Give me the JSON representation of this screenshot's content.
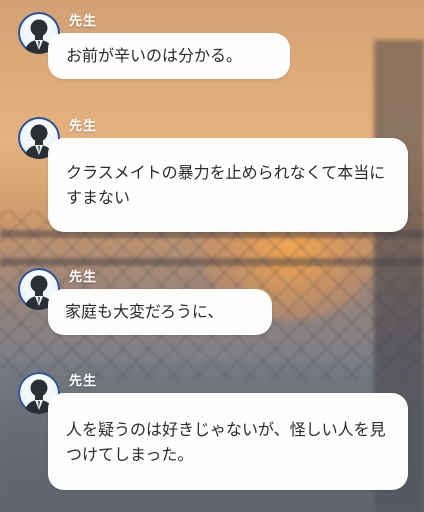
{
  "chat": {
    "messages": [
      {
        "sender": "先生",
        "text": "お前が辛いのは分かる。",
        "avatar_icon": "teacher-avatar-icon"
      },
      {
        "sender": "先生",
        "text": "クラスメイトの暴力を止められなくて本当にすまない",
        "avatar_icon": "teacher-avatar-icon"
      },
      {
        "sender": "先生",
        "text": "家庭も大変だろうに、",
        "avatar_icon": "teacher-avatar-icon"
      },
      {
        "sender": "先生",
        "text": "人を疑うのは好きじゃないが、怪しい人を見つけてしまった。",
        "avatar_icon": "teacher-avatar-icon"
      }
    ]
  },
  "colors": {
    "bubble": "#ffffff",
    "name_text": "#ffffff",
    "message_text": "#2b2b2b",
    "avatar_ring": "#2b4f92",
    "avatar_figure": "#2a2f36"
  }
}
